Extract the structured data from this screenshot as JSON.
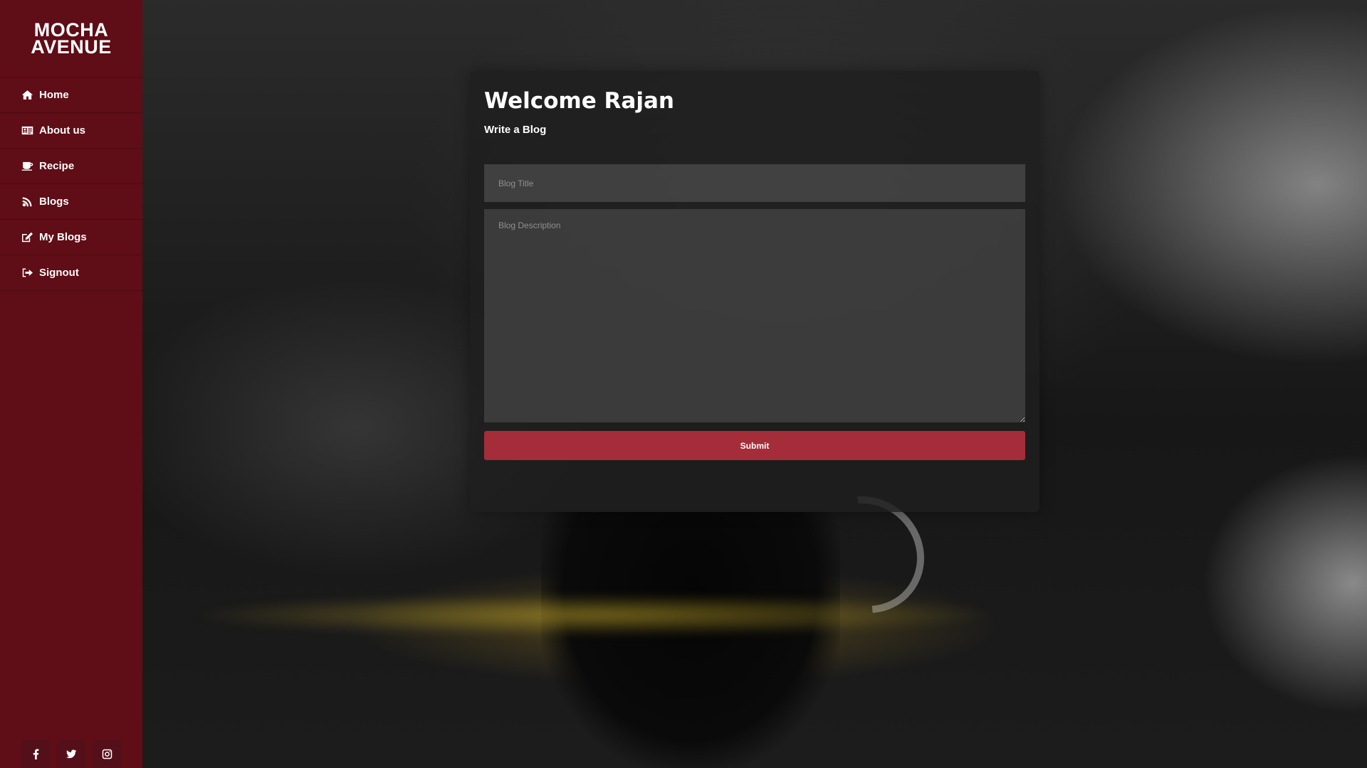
{
  "brand": {
    "line1": "MOCHA",
    "line2": "AVENUE"
  },
  "sidebar": {
    "items": [
      {
        "label": "Home",
        "icon": "home-icon"
      },
      {
        "label": "About us",
        "icon": "id-card-icon"
      },
      {
        "label": "Recipe",
        "icon": "coffee-cup-icon"
      },
      {
        "label": "Blogs",
        "icon": "rss-icon"
      },
      {
        "label": "My Blogs",
        "icon": "edit-icon"
      },
      {
        "label": "Signout",
        "icon": "sign-out-icon"
      }
    ]
  },
  "social": [
    "facebook-icon",
    "twitter-icon",
    "instagram-icon"
  ],
  "form": {
    "welcome": "Welcome Rajan",
    "subtitle": "Write a Blog",
    "title_placeholder": "Blog Title",
    "description_placeholder": "Blog Description",
    "submit_label": "Submit"
  },
  "colors": {
    "sidebar": "#5f0d16",
    "accent": "#a52d39"
  }
}
